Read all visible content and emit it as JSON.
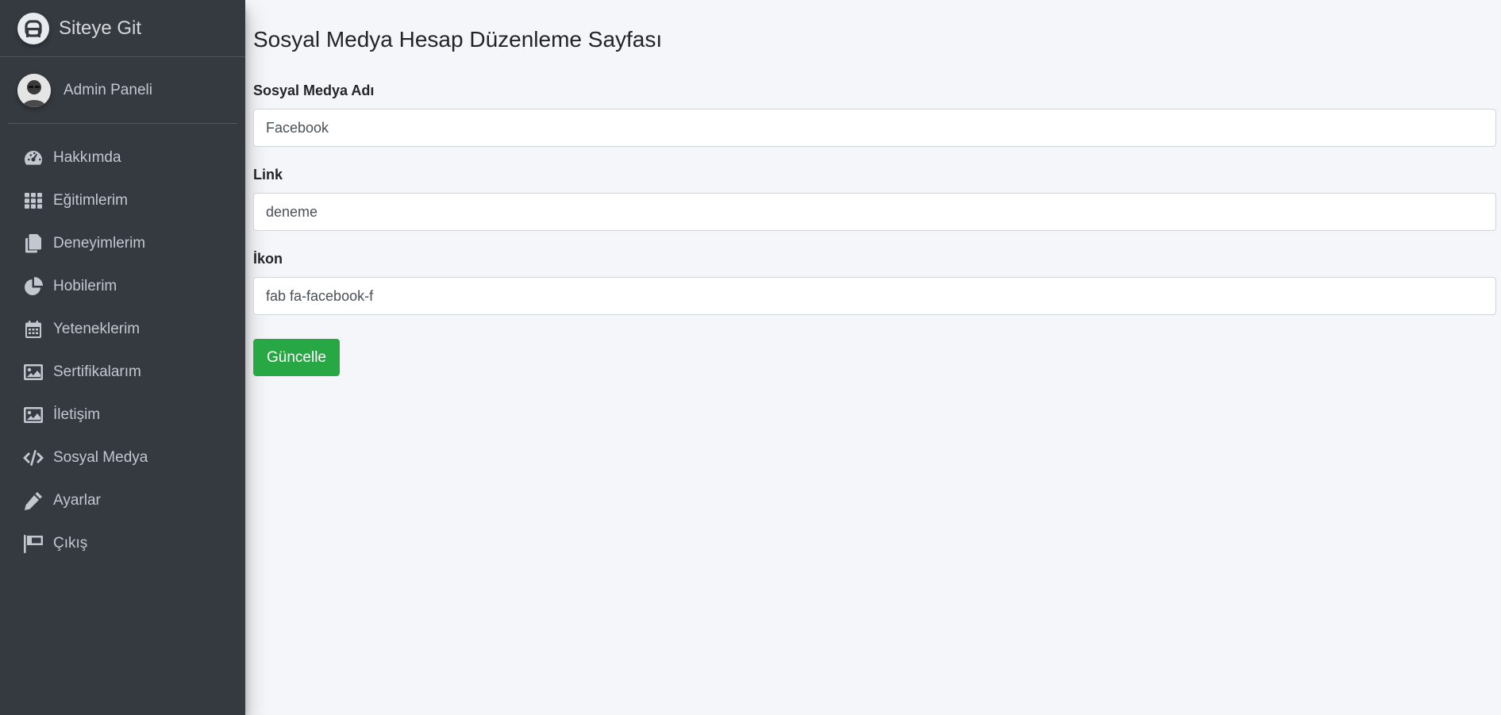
{
  "brand": {
    "text": "Siteye Git",
    "logo_icon": "rocket-logo-icon"
  },
  "user": {
    "name": "Admin Paneli",
    "avatar_icon": "user-avatar"
  },
  "nav": [
    {
      "label": "Hakkımda",
      "icon": "tachometer-icon"
    },
    {
      "label": "Eğitimlerim",
      "icon": "grid-icon"
    },
    {
      "label": "Deneyimlerim",
      "icon": "copy-icon"
    },
    {
      "label": "Hobilerim",
      "icon": "chart-pie-icon"
    },
    {
      "label": "Yeteneklerim",
      "icon": "calendar-icon"
    },
    {
      "label": "Sertifikalarım",
      "icon": "image-icon"
    },
    {
      "label": "İletişim",
      "icon": "image-icon"
    },
    {
      "label": "Sosyal Medya",
      "icon": "code-icon"
    },
    {
      "label": "Ayarlar",
      "icon": "pencil-icon"
    },
    {
      "label": "Çıkış",
      "icon": "flag-icon"
    }
  ],
  "page": {
    "title": "Sosyal Medya Hesap Düzenleme Sayfası"
  },
  "form": {
    "name_label": "Sosyal Medya Adı",
    "name_value": "Facebook",
    "link_label": "Link",
    "link_value": "deneme",
    "icon_label": "İkon",
    "icon_value": "fab fa-facebook-f",
    "submit_label": "Güncelle"
  },
  "colors": {
    "sidebar_bg": "#343a40",
    "content_bg": "#f4f6f9",
    "button_bg": "#28a745",
    "nav_text": "#c2c7d0"
  }
}
